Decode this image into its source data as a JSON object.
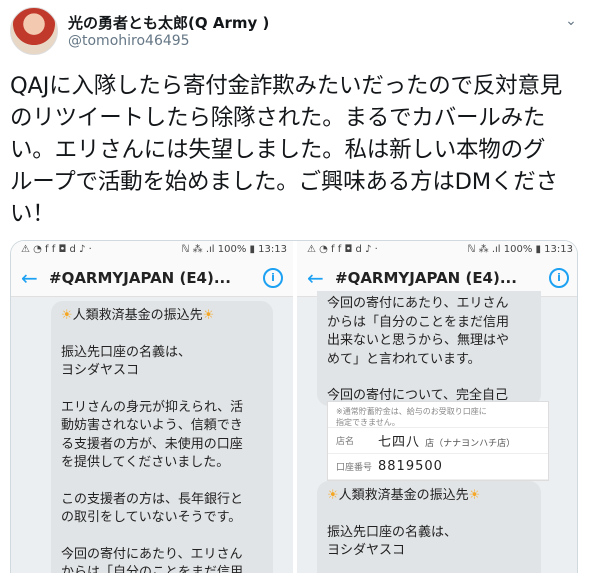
{
  "user": {
    "display_name": "光の勇者とも太郎(Q Army )",
    "handle": "@tomohiro46495"
  },
  "tweet": {
    "lines": [
      "QAJに入隊したら寄付金詐欺みたいだったので反対意見",
      "のリツイートしたら除隊された。まるでカバールみた",
      "い。エリさんには失望しました。私は新しい本物のグ",
      "ループで活動を始めました。ご興味ある方はDMくださ",
      "い！"
    ]
  },
  "left_phone": {
    "status_left": "⚠ ◔ f f ◘ d ♪ ·",
    "status_right": "ℕ ⁂ .ıl 100% ▮ 13:13",
    "title": "#QARMYJAPAN (E4)...",
    "bubble": {
      "heading": "人類救済基金の振込先",
      "sun": "☀",
      "lines": [
        "振込先口座の名義は、",
        "ヨシダヤスコ",
        "",
        "エリさんの身元が抑えられ、活",
        "動妨害されないよう、信頼でき",
        "る支援者の方が、未使用の口座",
        "を提供してくださいました。",
        "",
        "この支援者の方は、長年銀行と",
        "の取引をしていないそうです。",
        "",
        "今回の寄付にあたり、エリさん",
        "からは「自分のことをまだ信用"
      ]
    }
  },
  "right_phone": {
    "status_left": "⚠ ◔ f f ◘ d ♪ ·",
    "status_right": "ℕ ⁂ .ıl 100% ▮ 13:13",
    "title": "#QARMYJAPAN (E4)...",
    "bubble_top": {
      "lines": [
        "今回の寄付にあたり、エリさん",
        "からは「自分のことをまだ信用",
        "出来ないと思うから、無理はや",
        "めて」と言われています。",
        "",
        "今回の寄付について、完全自己"
      ]
    },
    "passbook": {
      "note_1": "※通常貯蓄貯金は、給与のお受取り口座に",
      "note_2": "指定できません。",
      "store_key": "店名",
      "store_val": "七四八",
      "store_sub": "店（ナナヨンハチ店）",
      "account_key": "口座番号",
      "account_val": "8819500"
    },
    "bubble_bottom": {
      "heading": "人類救済基金の振込先",
      "sun": "☀",
      "lines": [
        "振込先口座の名義は、",
        "ヨシダヤスコ"
      ]
    }
  },
  "colors": {
    "accent": "#1da1f2",
    "bubble": "#e1e4e6",
    "sun": "#f5a623"
  },
  "icons": {
    "back": "←",
    "info": "i",
    "menu": "⌄"
  }
}
